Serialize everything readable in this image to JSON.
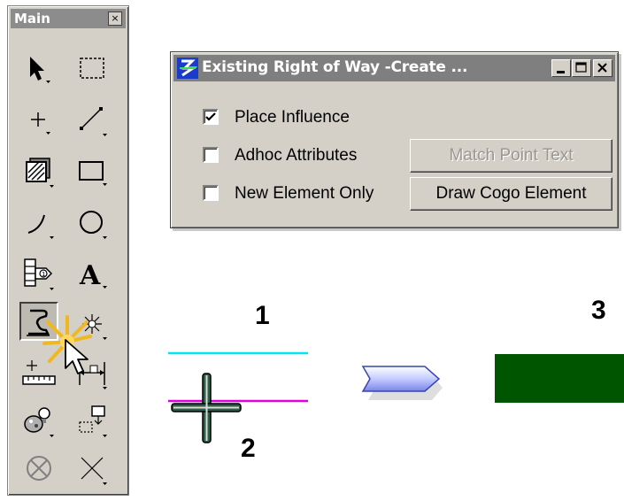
{
  "palette": {
    "title": "Main",
    "close_glyph": "×",
    "tools": [
      {
        "icon": "select-arrow-icon"
      },
      {
        "icon": "fence-icon"
      },
      {
        "icon": "point-icon"
      },
      {
        "icon": "line-icon"
      },
      {
        "icon": "hatch-icon"
      },
      {
        "icon": "rectangle-icon"
      },
      {
        "icon": "arc-icon"
      },
      {
        "icon": "circle-icon"
      },
      {
        "icon": "cell-icon"
      },
      {
        "icon": "text-icon"
      },
      {
        "icon": "custom-tool-icon",
        "active": true
      },
      {
        "icon": "sparkle-icon"
      },
      {
        "icon": "measure-icon"
      },
      {
        "icon": "dimension-icon"
      },
      {
        "icon": "palette-bulb-icon"
      },
      {
        "icon": "copy-icon"
      },
      {
        "icon": "delete-icon"
      },
      {
        "icon": "cross-icon"
      }
    ]
  },
  "dialog": {
    "title": "Existing Right of Way -Create ...",
    "checkboxes": [
      {
        "label": "Place Influence",
        "checked": true
      },
      {
        "label": "Adhoc Attributes",
        "checked": false
      },
      {
        "label": "New Element Only",
        "checked": false
      }
    ],
    "buttons": {
      "match_point_text": "Match Point Text",
      "draw_cogo_element": "Draw Cogo Element"
    }
  },
  "diagram": {
    "step1": "1",
    "step2": "2",
    "step3": "3",
    "colors": {
      "cyan_line": "#00e5ee",
      "magenta_line": "#e000e0",
      "result_rect": "#005500",
      "arrow_fill": "#c4ccff"
    }
  }
}
